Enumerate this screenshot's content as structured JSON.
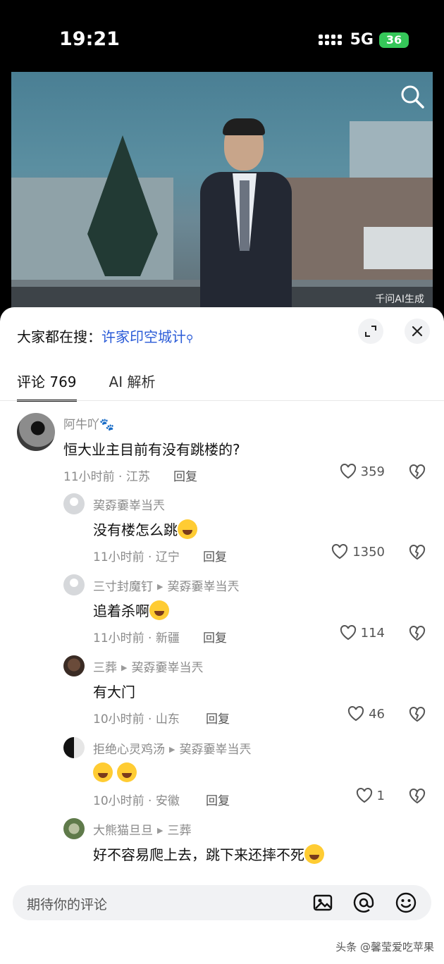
{
  "status": {
    "time": "19:21",
    "network": "5G",
    "battery": "36"
  },
  "video": {
    "watermark": "千问AI生成"
  },
  "search_hint": {
    "prefix": "大家都在搜：",
    "keyword": "许家印空城计"
  },
  "tabs": [
    {
      "label": "评论 769",
      "active": true
    },
    {
      "label": "AI 解析",
      "active": false
    }
  ],
  "comments": [
    {
      "user": "阿牛吖🐾",
      "text": "恒大业主目前有没有跳楼的?",
      "meta": "11小时前 · 江苏",
      "reply": "回复",
      "likes": "359"
    },
    {
      "user": "巭孬嫑峷当兲",
      "text": "没有楼怎么跳",
      "meta": "11小时前 · 辽宁",
      "reply": "回复",
      "likes": "1350"
    },
    {
      "user": "三寸封魔钉",
      "to": "巭孬嫑峷当兲",
      "text": "追着杀啊",
      "meta": "11小时前 · 新疆",
      "reply": "回复",
      "likes": "114"
    },
    {
      "user": "三葬",
      "to": "巭孬嫑峷当兲",
      "text": "有大门",
      "meta": "10小时前 · 山东",
      "reply": "回复",
      "likes": "46"
    },
    {
      "user": "拒绝心灵鸡汤",
      "to": "巭孬嫑峷当兲",
      "text": "",
      "meta": "10小时前 · 安徽",
      "reply": "回复",
      "likes": "1"
    },
    {
      "user": "大熊猫旦旦",
      "to": "三葬",
      "text": "好不容易爬上去，跳下来还摔不死"
    }
  ],
  "input": {
    "placeholder": "期待你的评论"
  },
  "footer": {
    "watermark": "头条 @馨莹爱吃苹果"
  }
}
